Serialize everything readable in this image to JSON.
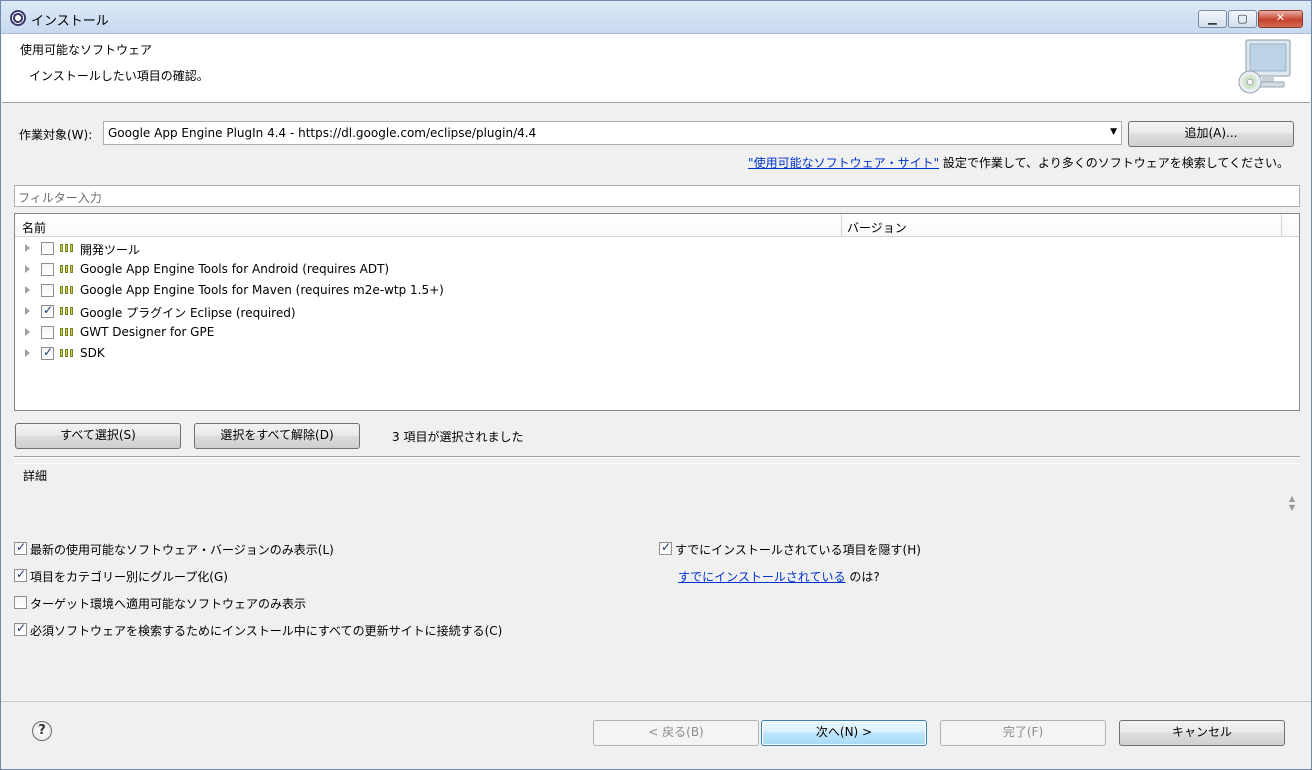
{
  "window": {
    "title": "インストール"
  },
  "banner": {
    "title": "使用可能なソフトウェア",
    "message": "インストールしたい項目の確認。"
  },
  "work_with": {
    "label": "作業対象(W):",
    "value": "Google App Engine PlugIn 4.4 - https://dl.google.com/eclipse/plugin/4.4",
    "add_button": "追加(A)..."
  },
  "sites_hint": {
    "link": "\"使用可能なソフトウェア・サイト\"",
    "text": " 設定で作業して、より多くのソフトウェアを検索してください。"
  },
  "filter": {
    "placeholder": "フィルター入力"
  },
  "table": {
    "columns": [
      "名前",
      "バージョン"
    ],
    "rows": [
      {
        "label": "開発ツール",
        "checked": false
      },
      {
        "label": "Google App Engine Tools for Android (requires ADT)",
        "checked": false
      },
      {
        "label": "Google App Engine Tools for Maven (requires m2e-wtp 1.5+)",
        "checked": false
      },
      {
        "label": "Google プラグイン Eclipse (required)",
        "checked": true
      },
      {
        "label": "GWT Designer for GPE",
        "checked": false
      },
      {
        "label": "SDK",
        "checked": true
      }
    ]
  },
  "selection": {
    "select_all": "すべて選択(S)",
    "deselect_all": "選択をすべて解除(D)",
    "count_text": "3 項目が選択されました"
  },
  "details": {
    "label": "詳細"
  },
  "options": {
    "latest_only": {
      "label": "最新の使用可能なソフトウェア・バージョンのみ表示(L)",
      "checked": true
    },
    "group_by_category": {
      "label": "項目をカテゴリー別にグループ化(G)",
      "checked": true
    },
    "target_env_only": {
      "label": "ターゲット環境へ適用可能なソフトウェアのみ表示",
      "checked": false
    },
    "contact_sites": {
      "label": "必須ソフトウェアを検索するためにインストール中にすべての更新サイトに接続する(C)",
      "checked": true
    },
    "hide_installed": {
      "label": "すでにインストールされている項目を隠す(H)",
      "checked": true
    },
    "already_installed_link": "すでにインストールされている",
    "already_installed_suffix": " のは?"
  },
  "footer": {
    "help_icon": "?",
    "back": "< 戻る(B)",
    "next": "次へ(N) >",
    "finish": "完了(F)",
    "cancel": "キャンセル"
  },
  "icons": {
    "app": "eclipse-icon",
    "banner": "install-monitor-cd-icon",
    "category": "category-icon",
    "expander": "tree-expand-icon"
  }
}
